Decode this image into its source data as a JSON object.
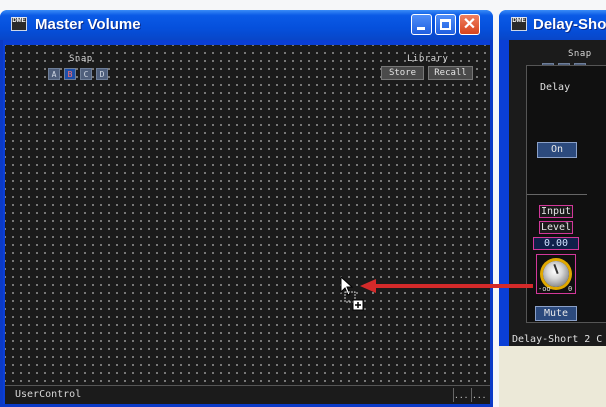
{
  "master_window": {
    "icon_text": "DME",
    "title": "Master Volume",
    "snap": {
      "label": "Snap",
      "buttons": [
        "A",
        "B",
        "C",
        "D"
      ],
      "active": "B"
    },
    "library": {
      "label": "Library",
      "store": "Store",
      "recall": "Recall"
    },
    "status": "UserControl",
    "status_seg_1": "...",
    "status_seg_2": "..."
  },
  "delay_window": {
    "icon_text": "DME",
    "title": "Delay-Sho",
    "snap": {
      "label": "Snap",
      "buttons": [
        "A",
        "B",
        "C"
      ]
    },
    "delay_label": "Delay",
    "on_label": "On",
    "input_label": "Input",
    "level_label": "Level",
    "level_value": "0.00",
    "knob_min": "-oo",
    "knob_max": "0",
    "mute_label": "Mute",
    "status": "Delay-Short  2 C"
  },
  "colors": {
    "titlebar": "#0550dc",
    "canvas": "#1b1b1b",
    "arrow": "#d42a2a",
    "highlight": "#d2389a"
  }
}
